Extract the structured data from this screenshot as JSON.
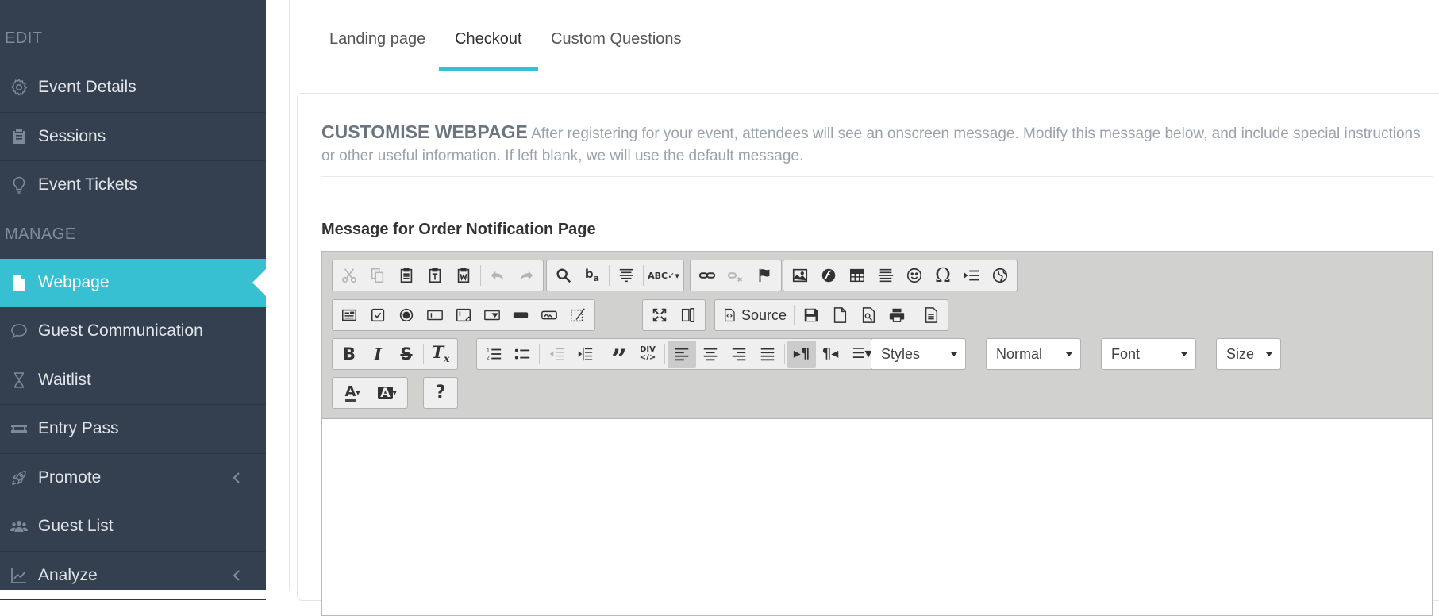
{
  "sidebar": {
    "sections": {
      "edit": "EDIT",
      "manage": "MANAGE"
    },
    "edit_items": [
      {
        "label": "Event Details",
        "icon": "gear-icon"
      },
      {
        "label": "Sessions",
        "icon": "clipboard-icon"
      },
      {
        "label": "Event Tickets",
        "icon": "lightbulb-icon"
      }
    ],
    "manage_items": [
      {
        "label": "Webpage",
        "icon": "file-icon",
        "active": true
      },
      {
        "label": "Guest Communication",
        "icon": "chat-bubble-icon"
      },
      {
        "label": "Waitlist",
        "icon": "hourglass-icon"
      },
      {
        "label": "Entry Pass",
        "icon": "ticket-icon"
      },
      {
        "label": "Promote",
        "icon": "rocket-icon",
        "chevron": true
      },
      {
        "label": "Guest List",
        "icon": "users-icon"
      },
      {
        "label": "Analyze",
        "icon": "chart-icon",
        "chevron": true
      }
    ],
    "accent_color": "#36c0d2",
    "background_color": "#34404f"
  },
  "tabs": [
    {
      "label": "Landing page"
    },
    {
      "label": "Checkout",
      "active": true
    },
    {
      "label": "Custom Questions"
    }
  ],
  "panel": {
    "heading": "CUSTOMISE WEBPAGE",
    "description": "After registering for your event, attendees will see an onscreen message. Modify this message below, and include special instructions or other useful information. If left blank, we will use the default message.",
    "field_label": "Message for Order Notification Page"
  },
  "editor": {
    "source_label": "Source",
    "combos": {
      "styles": "Styles",
      "format": "Normal",
      "font": "Font",
      "size": "Size"
    },
    "help_label": "?",
    "content": ""
  }
}
